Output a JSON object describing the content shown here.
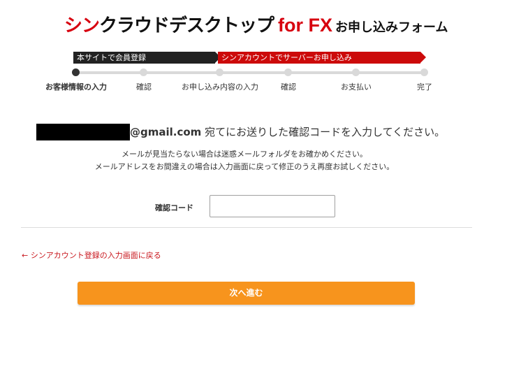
{
  "header": {
    "brand_red": "シン",
    "brand_black": "クラウドデスクトップ",
    "brand_fx": "for FX",
    "form_title": "お申し込みフォーム"
  },
  "banners": {
    "site_registration": "本サイトで会員登録",
    "server_application": "シンアカウントでサーバーお申し込み"
  },
  "steps": [
    {
      "label": "お客様情報の入力",
      "active": true
    },
    {
      "label": "確認",
      "active": false
    },
    {
      "label": "お申し込み内容の入力",
      "active": false
    },
    {
      "label": "確認",
      "active": false
    },
    {
      "label": "お支払い",
      "active": false
    },
    {
      "label": "完了",
      "active": false
    }
  ],
  "message": {
    "email_domain": "@gmail.com",
    "sent_text": " 宛てにお送りした確認コードを入力してください。",
    "note1": "メールが見当たらない場合は迷惑メールフォルダをお確かめください。",
    "note2": "メールアドレスをお間違えの場合は入力画面に戻って修正のうえ再度お試しください。"
  },
  "form": {
    "code_label": "確認コード",
    "code_value": ""
  },
  "back_link": "← シンアカウント登録の入力画面に戻る",
  "next_button": "次へ進む",
  "colors": {
    "brand_red": "#d7000f",
    "banner_black": "#222222",
    "banner_red": "#cc0a0a",
    "button_orange": "#f7941d",
    "link_red": "#c8161d"
  }
}
